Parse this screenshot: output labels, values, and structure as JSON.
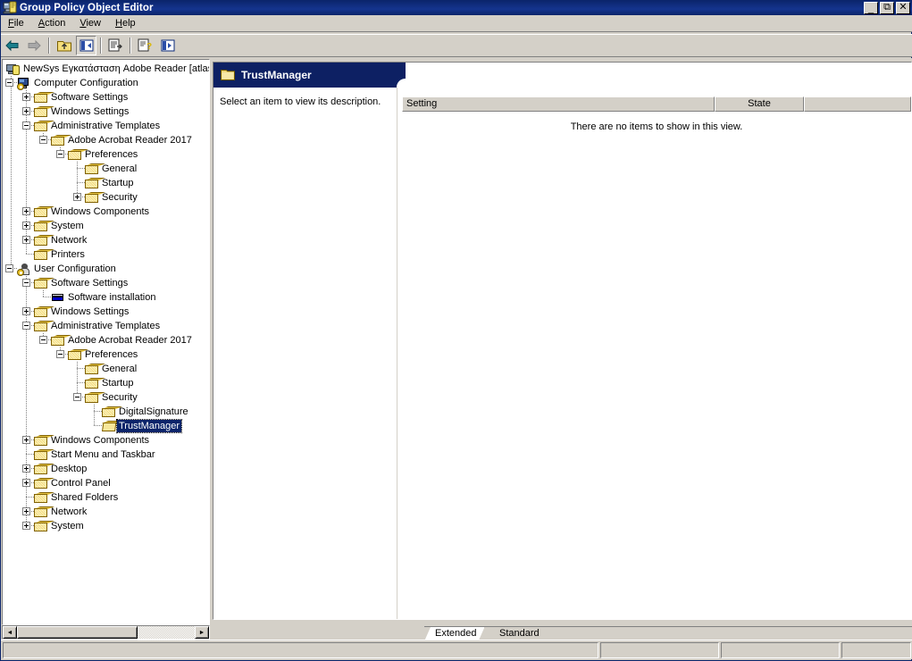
{
  "window": {
    "title": "Group Policy Object Editor",
    "icon": "group-policy-icon",
    "minimize_label": "_",
    "maximize_label": "❐",
    "close_label": "✕"
  },
  "menubar": {
    "items": [
      {
        "label": "File",
        "accel": "F"
      },
      {
        "label": "Action",
        "accel": "A"
      },
      {
        "label": "View",
        "accel": "V"
      },
      {
        "label": "Help",
        "accel": "H"
      }
    ]
  },
  "toolbar": {
    "buttons": [
      {
        "name": "back-button",
        "icon": "arrow-left-icon",
        "enabled": true
      },
      {
        "name": "forward-button",
        "icon": "arrow-right-icon",
        "enabled": false
      },
      {
        "name": "up-one-level-button",
        "icon": "folder-up-icon",
        "enabled": true
      },
      {
        "name": "show-hide-tree-button",
        "icon": "show-tree-icon",
        "enabled": true,
        "pressed": true
      },
      {
        "name": "properties-button",
        "icon": "properties-icon",
        "enabled": true
      },
      {
        "name": "help-button",
        "icon": "help-document-icon",
        "enabled": true
      },
      {
        "name": "export-list-button",
        "icon": "export-list-icon",
        "enabled": true
      }
    ]
  },
  "tree": {
    "nodes": [
      {
        "label": "NewSys Εγκατάσταση Adobe Reader [atlas.",
        "depth": 0,
        "icon": "gpo-icon",
        "twisty": "none",
        "selected": false
      },
      {
        "label": "Computer Configuration",
        "depth": 1,
        "icon": "computer-config-icon",
        "twisty": "minus",
        "selected": false
      },
      {
        "label": "Software Settings",
        "depth": 2,
        "icon": "folder-icon",
        "twisty": "plus",
        "selected": false
      },
      {
        "label": "Windows Settings",
        "depth": 2,
        "icon": "folder-icon",
        "twisty": "plus",
        "selected": false
      },
      {
        "label": "Administrative Templates",
        "depth": 2,
        "icon": "folder-icon",
        "twisty": "minus",
        "selected": false
      },
      {
        "label": "Adobe Acrobat Reader 2017",
        "depth": 3,
        "icon": "folder-icon",
        "twisty": "minus",
        "selected": false
      },
      {
        "label": "Preferences",
        "depth": 4,
        "icon": "folder-icon",
        "twisty": "minus",
        "selected": false
      },
      {
        "label": "General",
        "depth": 5,
        "icon": "folder-icon",
        "twisty": "none",
        "selected": false
      },
      {
        "label": "Startup",
        "depth": 5,
        "icon": "folder-icon",
        "twisty": "none",
        "selected": false
      },
      {
        "label": "Security",
        "depth": 5,
        "icon": "folder-icon",
        "twisty": "plus",
        "selected": false
      },
      {
        "label": "Windows Components",
        "depth": 2,
        "icon": "folder-icon",
        "twisty": "plus",
        "selected": false
      },
      {
        "label": "System",
        "depth": 2,
        "icon": "folder-icon",
        "twisty": "plus",
        "selected": false
      },
      {
        "label": "Network",
        "depth": 2,
        "icon": "folder-icon",
        "twisty": "plus",
        "selected": false
      },
      {
        "label": "Printers",
        "depth": 2,
        "icon": "folder-icon",
        "twisty": "none",
        "selected": false
      },
      {
        "label": "User Configuration",
        "depth": 1,
        "icon": "user-config-icon",
        "twisty": "minus",
        "selected": false
      },
      {
        "label": "Software Settings",
        "depth": 2,
        "icon": "folder-icon",
        "twisty": "minus",
        "selected": false
      },
      {
        "label": "Software installation",
        "depth": 3,
        "icon": "software-installation-icon",
        "twisty": "none",
        "selected": false
      },
      {
        "label": "Windows Settings",
        "depth": 2,
        "icon": "folder-icon",
        "twisty": "plus",
        "selected": false
      },
      {
        "label": "Administrative Templates",
        "depth": 2,
        "icon": "folder-icon",
        "twisty": "minus",
        "selected": false
      },
      {
        "label": "Adobe Acrobat Reader 2017",
        "depth": 3,
        "icon": "folder-icon",
        "twisty": "minus",
        "selected": false
      },
      {
        "label": "Preferences",
        "depth": 4,
        "icon": "folder-icon",
        "twisty": "minus",
        "selected": false
      },
      {
        "label": "General",
        "depth": 5,
        "icon": "folder-icon",
        "twisty": "none",
        "selected": false
      },
      {
        "label": "Startup",
        "depth": 5,
        "icon": "folder-icon",
        "twisty": "none",
        "selected": false
      },
      {
        "label": "Security",
        "depth": 5,
        "icon": "folder-icon",
        "twisty": "minus",
        "selected": false
      },
      {
        "label": "DigitalSignature",
        "depth": 6,
        "icon": "folder-icon",
        "twisty": "none",
        "selected": false
      },
      {
        "label": "TrustManager",
        "depth": 6,
        "icon": "folder-open-icon",
        "twisty": "none",
        "selected": true
      },
      {
        "label": "Windows Components",
        "depth": 2,
        "icon": "folder-icon",
        "twisty": "plus",
        "selected": false
      },
      {
        "label": "Start Menu and Taskbar",
        "depth": 2,
        "icon": "folder-icon",
        "twisty": "none",
        "selected": false
      },
      {
        "label": "Desktop",
        "depth": 2,
        "icon": "folder-icon",
        "twisty": "plus",
        "selected": false
      },
      {
        "label": "Control Panel",
        "depth": 2,
        "icon": "folder-icon",
        "twisty": "plus",
        "selected": false
      },
      {
        "label": "Shared Folders",
        "depth": 2,
        "icon": "folder-icon",
        "twisty": "none",
        "selected": false
      },
      {
        "label": "Network",
        "depth": 2,
        "icon": "folder-icon",
        "twisty": "plus",
        "selected": false
      },
      {
        "label": "System",
        "depth": 2,
        "icon": "folder-icon",
        "twisty": "plus",
        "selected": false
      }
    ],
    "hscroll": {
      "left_arrow": "◄",
      "right_arrow": "►"
    }
  },
  "right_pane": {
    "banner": {
      "title": "TrustManager",
      "icon": "folder-icon"
    },
    "description": "Select an item to view its description.",
    "listview": {
      "columns": [
        {
          "label": "Setting",
          "name": "column-setting"
        },
        {
          "label": "State",
          "name": "column-state"
        },
        {
          "label": "",
          "name": "column-blank"
        }
      ],
      "empty_message": "There are no items to show in this view."
    },
    "tabs": [
      {
        "label": "Extended",
        "active": true
      },
      {
        "label": "Standard",
        "active": false
      }
    ]
  },
  "statusbar": {
    "panels": [
      "",
      "",
      "",
      ""
    ]
  },
  "colors": {
    "title_bar": "#0a246a",
    "banner": "#0d2063",
    "selection": "#0a246a",
    "face": "#d4d0c8",
    "folder": "#f5dd7a"
  }
}
